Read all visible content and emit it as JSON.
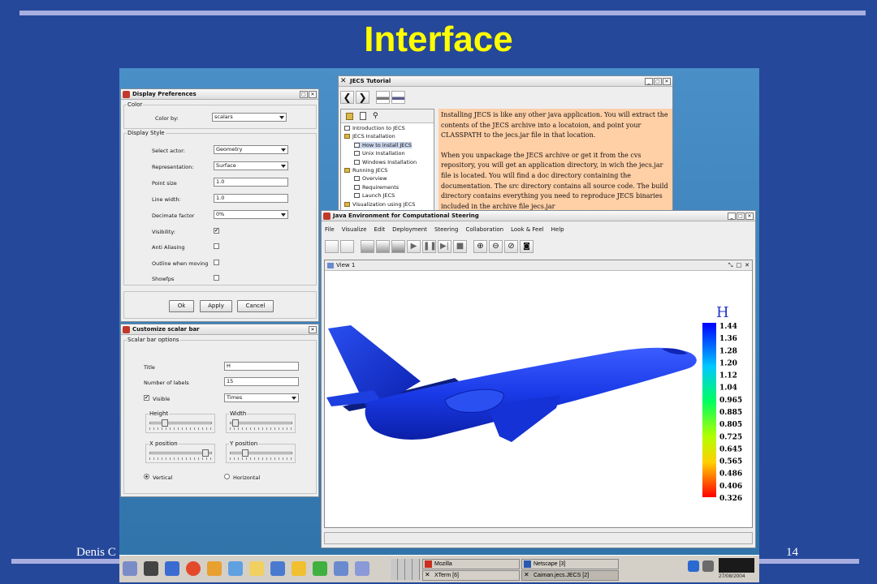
{
  "slide": {
    "title": "Interface",
    "footer_left": "Denis C",
    "page_number": "14"
  },
  "display_prefs": {
    "title": "Display Preferences",
    "color_group": "Color",
    "color_by_label": "Color by:",
    "color_by_value": "scalars",
    "style_group": "Display Style",
    "select_actor_label": "Select actor:",
    "select_actor_value": "Geometry",
    "representation_label": "Representation:",
    "representation_value": "Surface",
    "point_size_label": "Point size",
    "point_size_value": "1.0",
    "line_width_label": "Line width:",
    "line_width_value": "1.0",
    "decimate_label": "Decimate factor",
    "decimate_value": "0%",
    "visibility_label": "Visibility:",
    "anti_aliasing_label": "Anti Aliasing",
    "outline_label": "Outline when moving",
    "showfps_label": "Showfps",
    "ok_label": "Ok",
    "apply_label": "Apply",
    "cancel_label": "Cancel",
    "visibility_checked": "✔"
  },
  "scalar_bar": {
    "title": "Customize scalar bar",
    "options_group": "Scalar bar options",
    "title_label": "Title",
    "title_value": "H",
    "num_labels_label": "Number of labels",
    "num_labels_value": "15",
    "visible_label": "Visible",
    "visible_checked": "✔",
    "font_value": "Times",
    "height_label": "Height",
    "width_label": "Width",
    "xpos_label": "X position",
    "ypos_label": "Y position",
    "vertical_label": "Vertical",
    "horizontal_label": "Horizontal"
  },
  "tutorial": {
    "title": "JECS Tutorial",
    "tree": [
      {
        "label": "Introduction to JECS",
        "type": "doc",
        "indent": 0
      },
      {
        "label": "JECS Installation",
        "type": "folder",
        "indent": 0
      },
      {
        "label": "How to install JECS",
        "type": "doc",
        "indent": 1,
        "selected": true
      },
      {
        "label": "Unix Installation",
        "type": "doc",
        "indent": 1
      },
      {
        "label": "Windows Installation",
        "type": "doc",
        "indent": 1
      },
      {
        "label": "Running JECS",
        "type": "folder",
        "indent": 0
      },
      {
        "label": "Overview",
        "type": "doc",
        "indent": 1
      },
      {
        "label": "Requirements",
        "type": "doc",
        "indent": 1
      },
      {
        "label": "Launch JECS",
        "type": "doc",
        "indent": 1
      },
      {
        "label": "Visualization using JECS",
        "type": "folder",
        "indent": 0
      }
    ],
    "para1": "Installing JECS is like any other java application. You will extract the contents of the JECS archive into a locatoion, and point your CLASSPATH to the jecs.jar file in that location.",
    "para2": "When you unpackage the JECS archive or get it from the cvs repository, you will get an application directory, in wich the jecs.jar file is located. You will find a doc directory containing the documentation. The src directory contains all source code. The build directory contains everything you need to reproduce JECS binaries included in the archive file jecs.jar"
  },
  "jecs": {
    "title": "Java Environment for Computational Steering",
    "menu": [
      "File",
      "Visualize",
      "Edit",
      "Deployment",
      "Steering",
      "Collaboration",
      "Look & Feel",
      "Help"
    ],
    "view_title": "View 1",
    "legend_title": "H",
    "legend_labels": [
      "1.44",
      "1.36",
      "1.28",
      "1.20",
      "1.12",
      "1.04",
      "0.965",
      "0.885",
      "0.805",
      "0.725",
      "0.645",
      "0.565",
      "0.486",
      "0.406",
      "0.326"
    ]
  },
  "taskbar": {
    "mozilla": "Mozilla",
    "netscape": "Netscape [3]",
    "xterm": "XTerm [6]",
    "caiman": "Caiman.jecs.JECS [2]",
    "date": "27/08/2004"
  }
}
